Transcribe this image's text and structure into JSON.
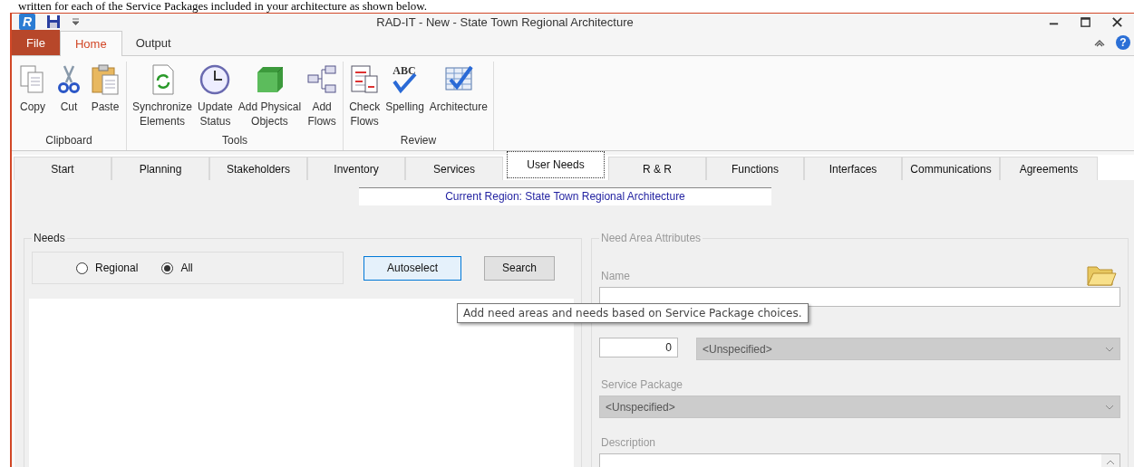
{
  "document_text": "written for each of the Service Packages included in your architecture as shown below.",
  "window": {
    "app_logo": "R",
    "title": "RAD-IT - New - State Town Regional Architecture",
    "help_glyph": "?"
  },
  "ribbon": {
    "tabs": [
      {
        "label": "File",
        "kind": "file",
        "selected": false
      },
      {
        "label": "Home",
        "kind": "tab",
        "selected": true
      },
      {
        "label": "Output",
        "kind": "tab",
        "selected": false
      }
    ],
    "groups": [
      {
        "label": "Clipboard",
        "buttons": [
          {
            "kind": "copy",
            "lines": [
              "Copy"
            ]
          },
          {
            "kind": "cut",
            "lines": [
              "Cut"
            ]
          },
          {
            "kind": "paste",
            "lines": [
              "Paste"
            ]
          }
        ]
      },
      {
        "label": "Tools",
        "buttons": [
          {
            "kind": "sync",
            "lines": [
              "Synchronize",
              "Elements"
            ]
          },
          {
            "kind": "clock",
            "lines": [
              "Update",
              "Status"
            ]
          },
          {
            "kind": "cube",
            "lines": [
              "Add Physical",
              "Objects"
            ]
          },
          {
            "kind": "flows",
            "lines": [
              "Add",
              "Flows"
            ]
          }
        ]
      },
      {
        "label": "Review",
        "buttons": [
          {
            "kind": "checkflows",
            "lines": [
              "Check",
              "Flows"
            ]
          },
          {
            "kind": "spelling",
            "icon_text": "ABC",
            "lines": [
              "Spelling"
            ]
          },
          {
            "kind": "architecture",
            "lines": [
              "Architecture"
            ]
          }
        ]
      }
    ]
  },
  "page_tabs": [
    {
      "label": "Start",
      "selected": false
    },
    {
      "label": "Planning",
      "selected": false
    },
    {
      "label": "Stakeholders",
      "selected": false
    },
    {
      "label": "Inventory",
      "selected": false
    },
    {
      "label": "Services",
      "selected": false
    },
    {
      "label": "User Needs",
      "selected": true
    },
    {
      "label": "R & R",
      "selected": false
    },
    {
      "label": "Functions",
      "selected": false
    },
    {
      "label": "Interfaces",
      "selected": false
    },
    {
      "label": "Communications",
      "selected": false
    },
    {
      "label": "Agreements",
      "selected": false
    }
  ],
  "region_label": "Current Region: State Town Regional Architecture",
  "needs": {
    "title": "Needs",
    "radios": [
      {
        "label": "Regional",
        "selected": false
      },
      {
        "label": "All",
        "selected": true
      }
    ],
    "buttons": [
      {
        "label": "Autoselect",
        "focused": true
      },
      {
        "label": "Search",
        "focused": false
      }
    ]
  },
  "tooltip": "Add need areas and needs based on Service Package choices.",
  "attributes": {
    "title": "Need Area Attributes",
    "name_label": "Name",
    "order_value": "0",
    "type_value": "<Unspecified>",
    "service_package_label": "Service Package",
    "service_package_value": "<Unspecified>",
    "description_label": "Description"
  }
}
